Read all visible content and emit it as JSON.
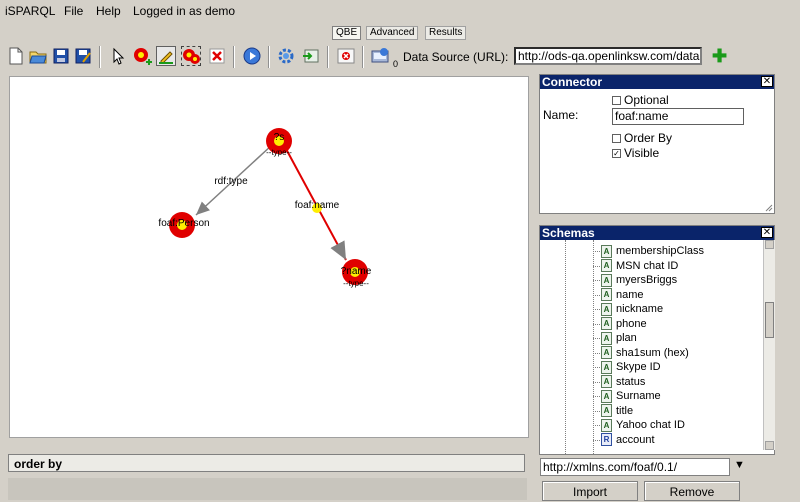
{
  "menubar": {
    "app": "iSPARQL",
    "file": "File",
    "help": "Help",
    "user": "Logged in as demo"
  },
  "tabs": [
    {
      "label": "QBE",
      "active": true
    },
    {
      "label": "Advanced",
      "active": false
    },
    {
      "label": "Results",
      "active": false
    }
  ],
  "toolbar": {
    "badge": "0",
    "data_source_label": "Data Source (URL):",
    "data_source_value": "http://ods-qa.openlinksw.com/datas|"
  },
  "graph": {
    "nodes": [
      {
        "label": "?s",
        "sub": "--type--"
      },
      {
        "label": "foaf:Person",
        "sub": ""
      },
      {
        "label": "?name",
        "sub": "--type--"
      }
    ],
    "edges": [
      {
        "label": "rdf:type"
      },
      {
        "label": "foaf:name"
      }
    ]
  },
  "order_by": {
    "label": "order by"
  },
  "connector": {
    "title": "Connector",
    "optional_label": "Optional",
    "optional_checked": false,
    "name_label": "Name:",
    "name_value": "foaf:name",
    "order_by_label": "Order By",
    "order_by_checked": false,
    "visible_label": "Visible",
    "visible_checked": true
  },
  "schemas": {
    "title": "Schemas",
    "items": [
      {
        "label": "membershipClass",
        "kind": "A"
      },
      {
        "label": "MSN chat ID",
        "kind": "A"
      },
      {
        "label": "myersBriggs",
        "kind": "A"
      },
      {
        "label": "name",
        "kind": "A"
      },
      {
        "label": "nickname",
        "kind": "A"
      },
      {
        "label": "phone",
        "kind": "A"
      },
      {
        "label": "plan",
        "kind": "A"
      },
      {
        "label": "sha1sum (hex)",
        "kind": "A"
      },
      {
        "label": "Skype ID",
        "kind": "A"
      },
      {
        "label": "status",
        "kind": "A"
      },
      {
        "label": "Surname",
        "kind": "A"
      },
      {
        "label": "title",
        "kind": "A"
      },
      {
        "label": "Yahoo chat ID",
        "kind": "A"
      },
      {
        "label": "account",
        "kind": "R"
      }
    ],
    "url": "http://xmlns.com/foaf/0.1/",
    "import_label": "Import",
    "remove_label": "Remove"
  },
  "colors": {
    "panel_title": "#0a246a",
    "node_red": "#e00000",
    "node_yellow": "#ffee00",
    "selected_edge": "#e00000",
    "edge_gray": "#808080"
  },
  "icons": [
    "new-file-icon",
    "open-folder-icon",
    "save-icon",
    "save-as-icon",
    "pointer-icon",
    "add-node-icon",
    "edit-icon",
    "select-nodes-icon",
    "delete-icon",
    "run-icon",
    "settings-icon",
    "export-icon",
    "error-icon",
    "data-source-icon",
    "add-icon"
  ]
}
